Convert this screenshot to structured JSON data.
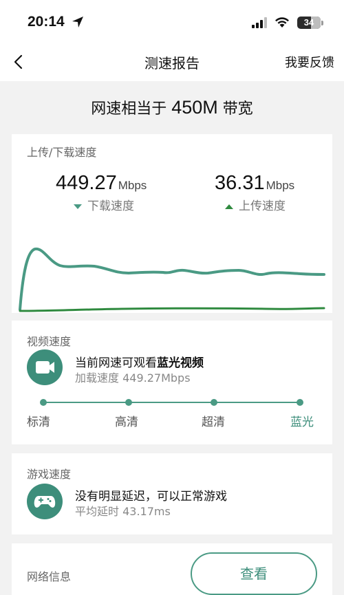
{
  "status_bar": {
    "time": "20:14",
    "battery": "34"
  },
  "nav": {
    "title": "测速报告",
    "feedback": "我要反馈"
  },
  "headline": {
    "prefix": "网速相当于",
    "speed": "450M",
    "suffix": "带宽"
  },
  "speed_card": {
    "title": "上传/下载速度",
    "download": {
      "value": "449.27",
      "unit": "Mbps",
      "label": "下载速度"
    },
    "upload": {
      "value": "36.31",
      "unit": "Mbps",
      "label": "上传速度"
    }
  },
  "video_card": {
    "title": "视频速度",
    "line1_prefix": "当前网速可观看",
    "line1_bold": "蓝光视频",
    "line2": "加载速度 449.27Mbps",
    "levels": [
      "标清",
      "高清",
      "超清",
      "蓝光"
    ],
    "active_level": "蓝光"
  },
  "game_card": {
    "title": "游戏速度",
    "line1": "没有明显延迟，可以正常游戏",
    "line2": "平均延时 43.17ms"
  },
  "network_card": {
    "title": "网络信息",
    "button": "查看"
  },
  "colors": {
    "accent": "#3d8e7b",
    "download_line": "#4a9a84",
    "upload_line": "#2f8a3f"
  },
  "icons": [
    "back-chevron-icon",
    "location-arrow-icon",
    "signal-icon",
    "wifi-icon",
    "battery-icon",
    "video-camera-icon",
    "gamepad-icon"
  ]
}
